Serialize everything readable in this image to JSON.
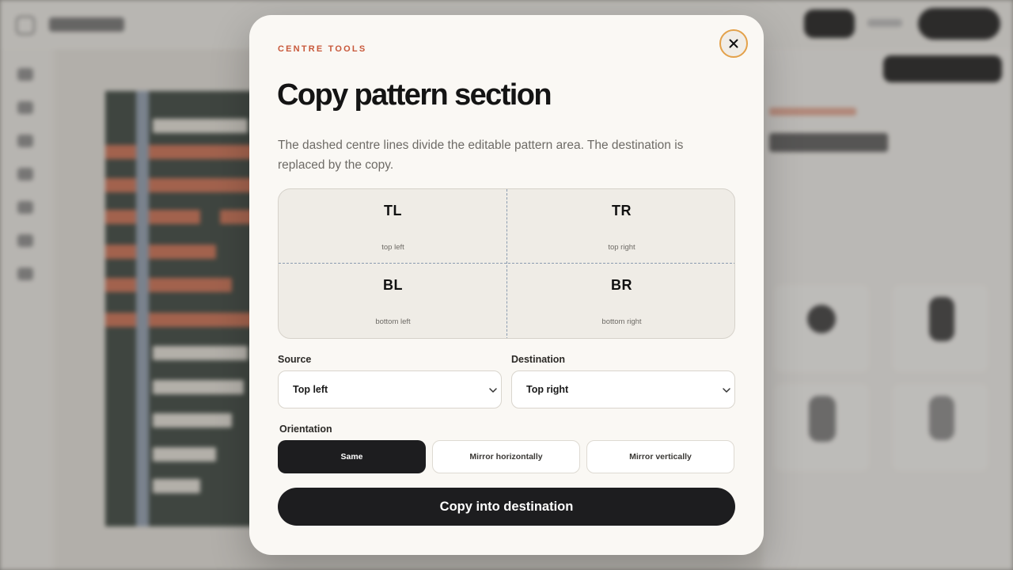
{
  "modal": {
    "eyebrow": "CENTRE TOOLS",
    "title": "Copy pattern section",
    "description": "The dashed centre lines divide the editable pattern area. The destination is replaced by the copy.",
    "quadrants": [
      {
        "code": "TL",
        "label": "top left"
      },
      {
        "code": "TR",
        "label": "top right"
      },
      {
        "code": "BL",
        "label": "bottom left"
      },
      {
        "code": "BR",
        "label": "bottom right"
      }
    ],
    "source": {
      "label": "Source",
      "value": "Top left"
    },
    "destination": {
      "label": "Destination",
      "value": "Top right"
    },
    "orientation": {
      "label": "Orientation",
      "options": [
        "Same",
        "Mirror horizontally",
        "Mirror vertically"
      ],
      "selected": "Same"
    },
    "submit_label": "Copy into destination",
    "close_icon": "close-icon"
  },
  "colors": {
    "accent": "#c8583a",
    "focus_ring": "#e3a14a",
    "primary": "#1d1d1f",
    "surface": "#faf8f4"
  }
}
